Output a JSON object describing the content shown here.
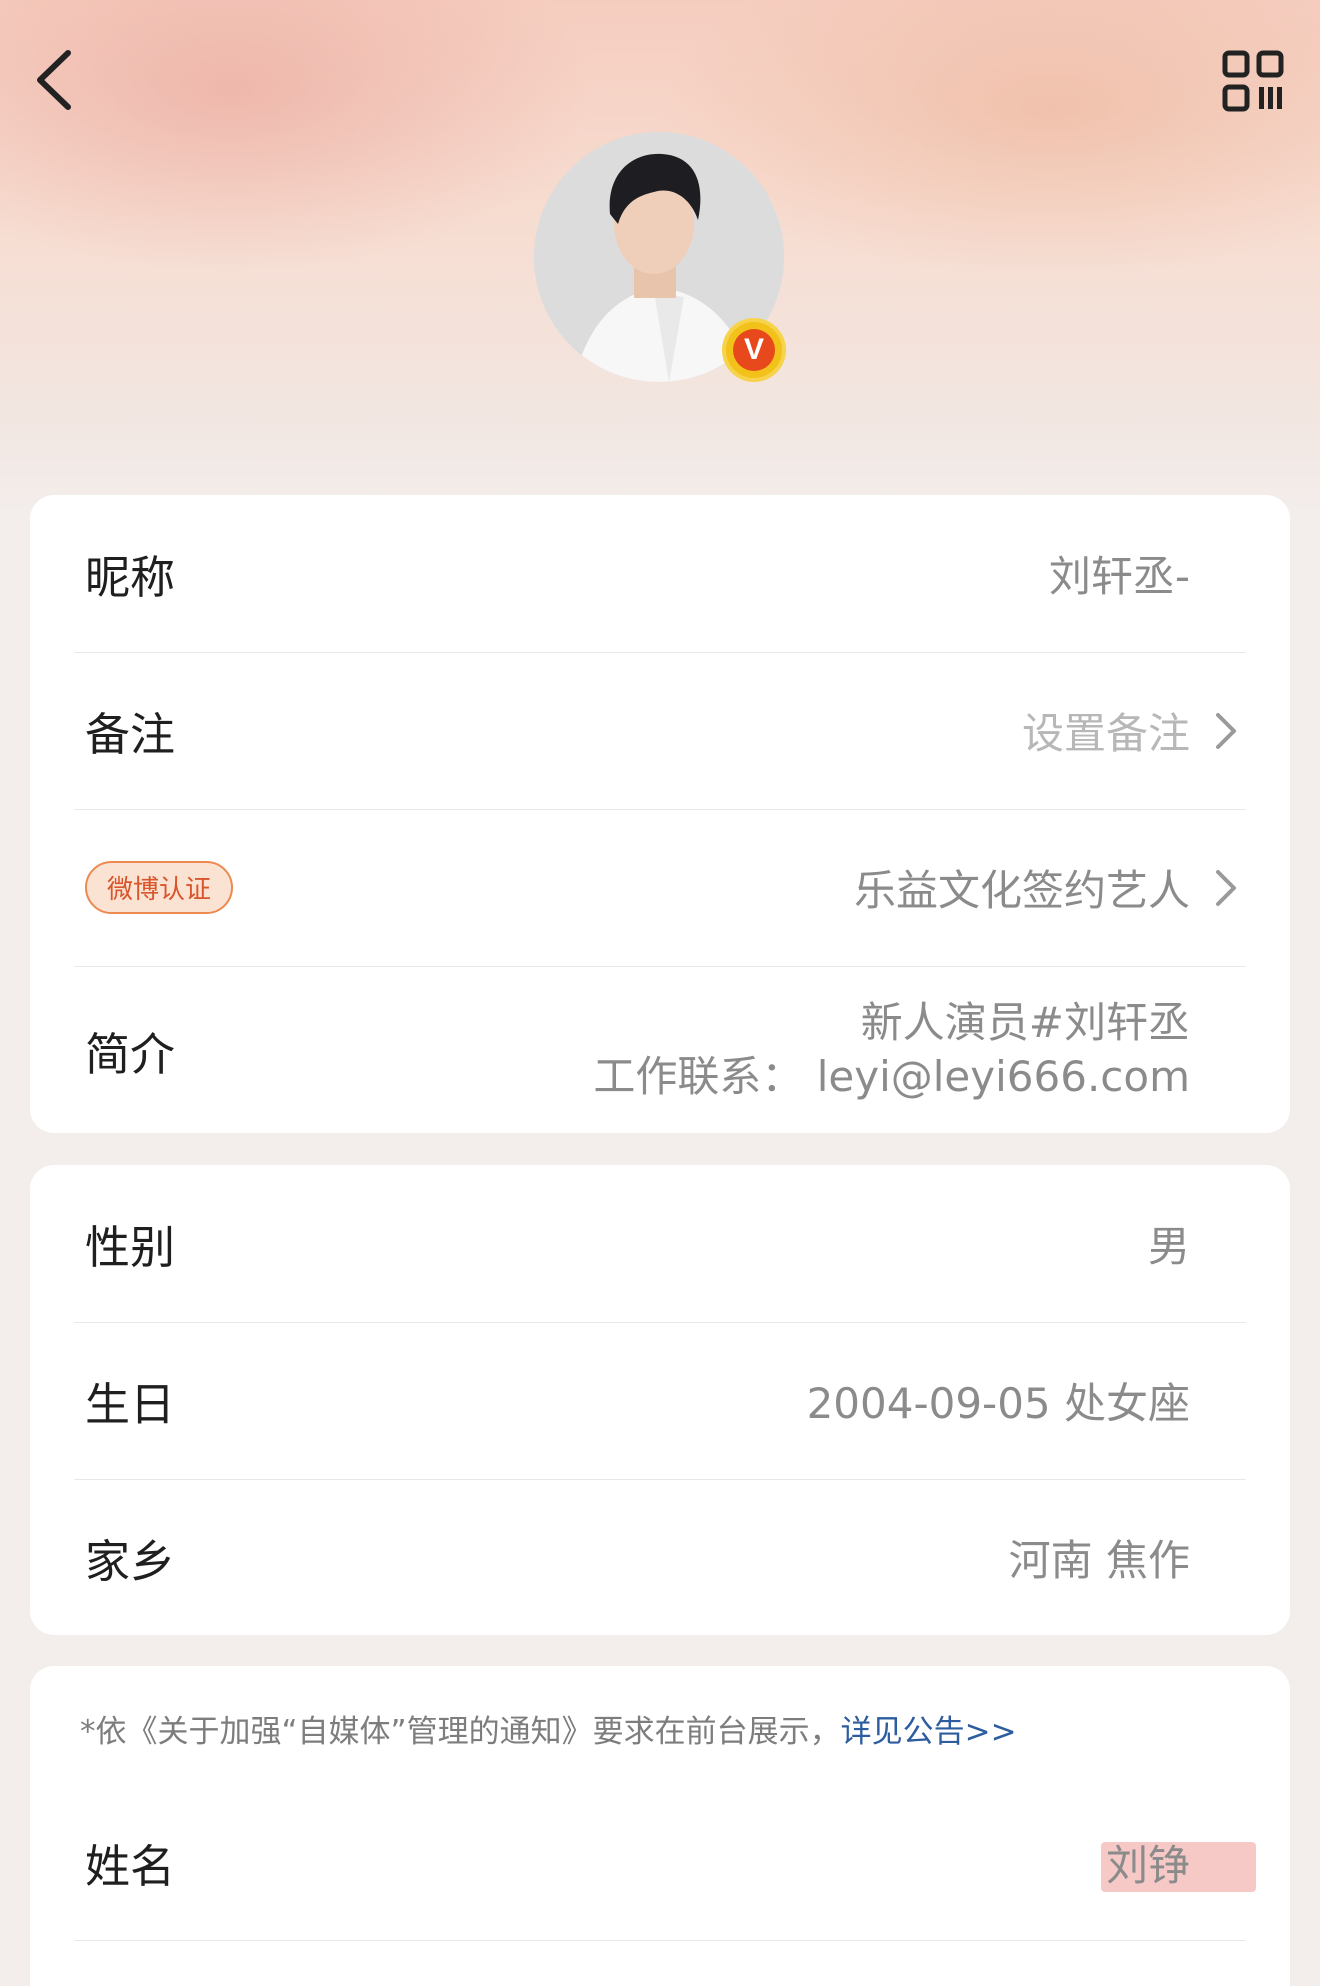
{
  "header": {
    "back_icon": "chevron-left-icon",
    "qr_icon": "qr-code-icon"
  },
  "profile": {
    "verified_badge": "V",
    "badge_colors": {
      "ring": "#f2c21a",
      "fill": "#e8491c"
    }
  },
  "basic_info": {
    "nickname_label": "昵称",
    "nickname_value": "刘轩丞-",
    "remark_label": "备注",
    "remark_value": "设置备注",
    "verify_tag": "微博认证",
    "verify_value": "乐益文化签约艺人",
    "intro_label": "简介",
    "intro_line1": "新人演员#刘轩丞",
    "intro_line2": "工作联系： leyi@leyi666.com"
  },
  "personal_info": {
    "gender_label": "性别",
    "gender_value": "男",
    "birthday_label": "生日",
    "birthday_value": "2004-09-05 处女座",
    "hometown_label": "家乡",
    "hometown_value": "河南 焦作"
  },
  "realname": {
    "notice_text": "*依《关于加强“自媒体”管理的通知》要求在前台展示，",
    "notice_link": "详见公告>>",
    "name_label": "姓名",
    "name_value": "刘铮"
  },
  "colors": {
    "link": "#2d5d9f",
    "tag_text": "#d9552b",
    "tag_border": "#ec8a52"
  }
}
